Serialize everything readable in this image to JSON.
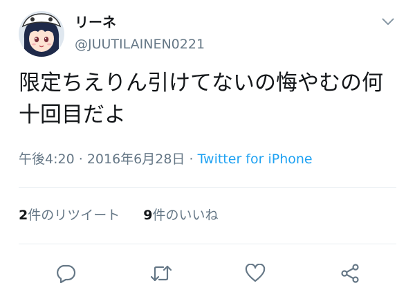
{
  "user": {
    "display_name": "リーネ",
    "handle": "@JUUTILAINEN0221"
  },
  "tweet": {
    "text": "限定ちえりん引けてないの悔やむの何十回目だよ",
    "time": "午後4:20",
    "separator": "·",
    "date": "2016年6月28日",
    "source": "Twitter for iPhone"
  },
  "stats": {
    "retweets_count": "2",
    "retweets_label": "件のリツイート",
    "likes_count": "9",
    "likes_label": "件のいいね"
  },
  "icons": {
    "caret": "chevron-down-icon",
    "reply": "reply-icon",
    "retweet": "retweet-icon",
    "like": "heart-icon",
    "share": "share-icon"
  },
  "colors": {
    "text": "#14171a",
    "secondary": "#657786",
    "link": "#1da1f2",
    "divider": "#e6ecf0"
  }
}
